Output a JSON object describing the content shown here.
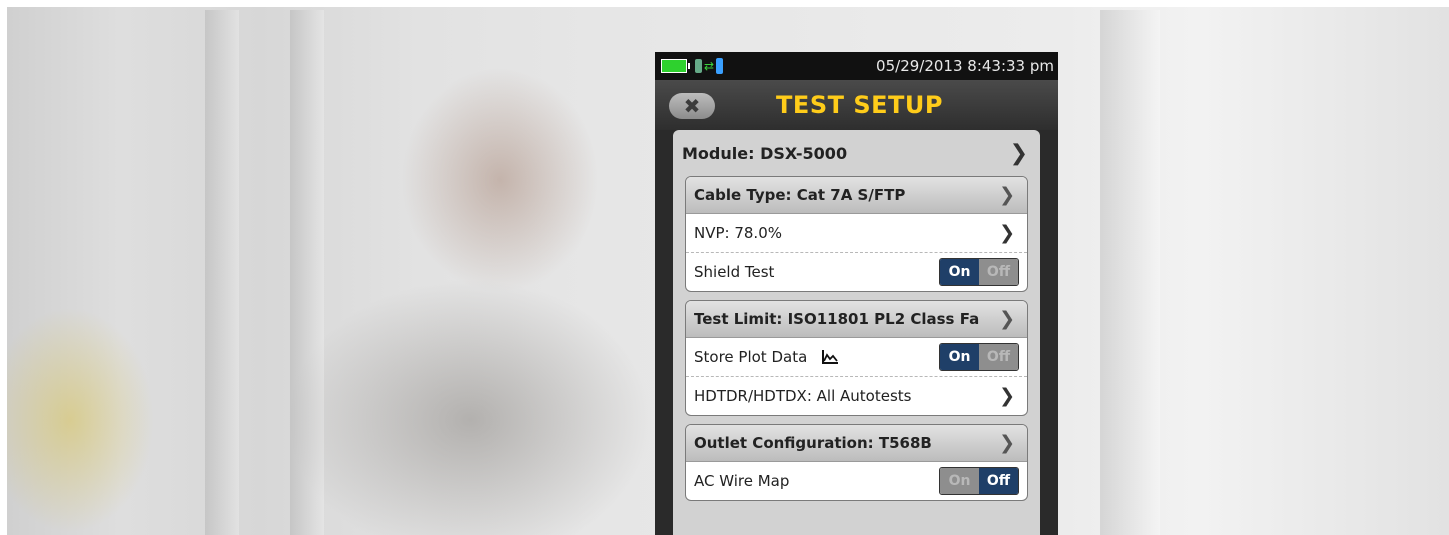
{
  "status": {
    "datetime": "05/29/2013 8:43:33 pm",
    "battery_color": "#2ed12e"
  },
  "header": {
    "title": "TEST SETUP",
    "close_icon": "close-icon"
  },
  "module": {
    "label": "Module: DSX-5000"
  },
  "groups": [
    {
      "header": "Cable Type: Cat 7A S/FTP",
      "rows": [
        {
          "label": "NVP: 78.0%"
        },
        {
          "label": "Shield Test",
          "toggle": {
            "on": "On",
            "off": "Off",
            "state": "On"
          }
        }
      ]
    },
    {
      "header": "Test Limit: ISO11801 PL2 Class Fa",
      "rows": [
        {
          "label": "Store Plot Data",
          "icon": "plot-graph-icon",
          "toggle": {
            "on": "On",
            "off": "Off",
            "state": "On"
          }
        },
        {
          "label": "HDTDR/HDTDX: All Autotests"
        }
      ]
    },
    {
      "header": "Outlet Configuration: T568B",
      "rows": [
        {
          "label": "AC Wire Map",
          "toggle": {
            "on": "On",
            "off": "Off",
            "state": "Off"
          }
        }
      ]
    }
  ],
  "colors": {
    "title": "#ffcc1a",
    "toggle_active": "#1f3f68"
  }
}
